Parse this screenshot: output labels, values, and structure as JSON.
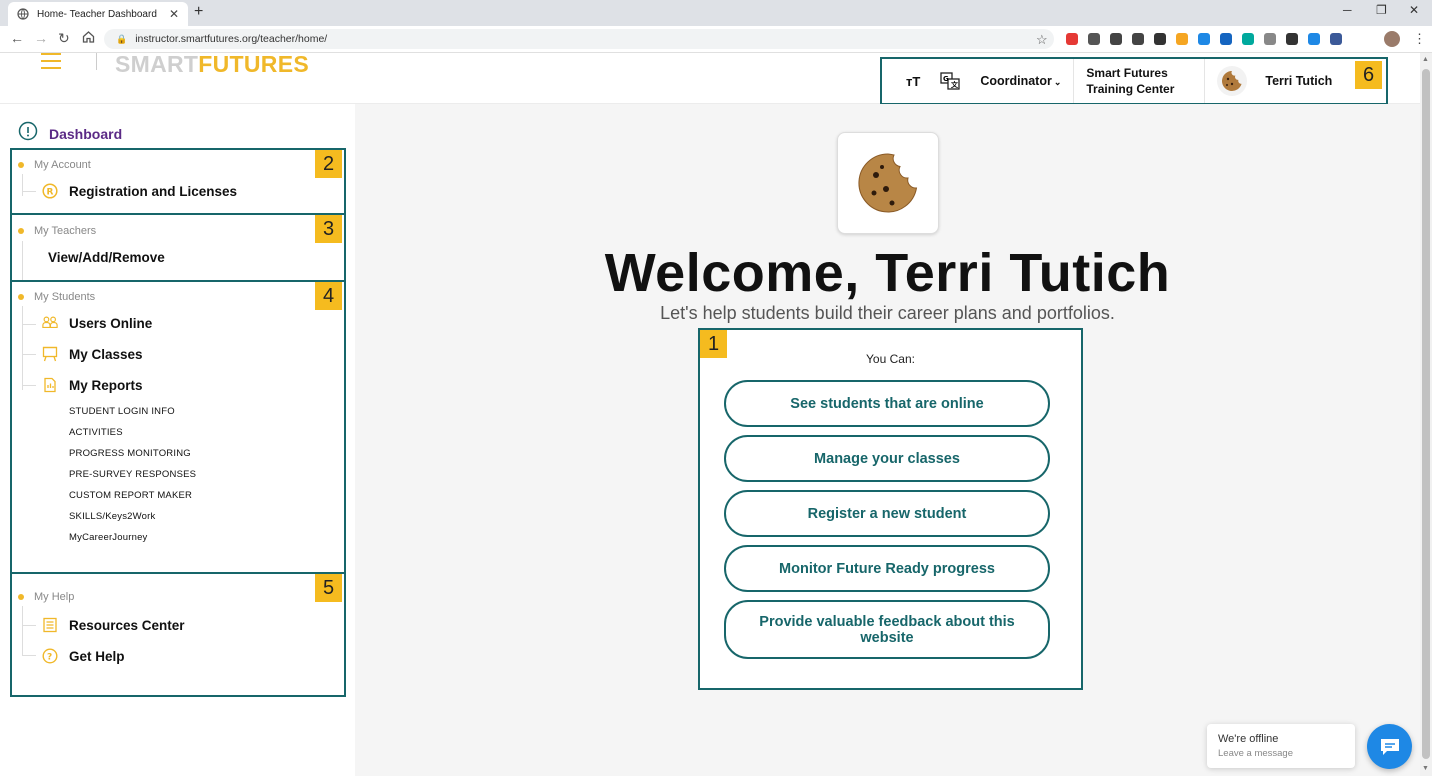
{
  "browser": {
    "tab_title": "Home- Teacher Dashboard",
    "tab_close": "✕",
    "new_tab": "+",
    "url": "instructor.smartfutures.org/teacher/home/",
    "extension_colors": [
      "#e53935",
      "#555555",
      "#444444",
      "#444444",
      "#333333",
      "#f5a623",
      "#1e88e5",
      "#1565c0",
      "#00a99d",
      "#888888",
      "#333333",
      "#1e88e5",
      "#3b5998"
    ]
  },
  "header": {
    "logo_part1": "SMART",
    "logo_part2": "FUTURES",
    "text_size": "ᴛT",
    "role": "Coordinator",
    "org_line1": "Smart Futures",
    "org_line2": "Training Center",
    "user_name": "Terri Tutich",
    "tag": "6"
  },
  "sidebar": {
    "dashboard": "Dashboard",
    "account": {
      "tag": "2",
      "section": "My Account",
      "items": [
        "Registration and Licenses"
      ]
    },
    "teachers": {
      "tag": "3",
      "section": "My Teachers",
      "items": [
        "View/Add/Remove"
      ]
    },
    "students": {
      "tag": "4",
      "section": "My Students",
      "items": [
        "Users Online",
        "My Classes",
        "My Reports"
      ],
      "reports": [
        "STUDENT LOGIN INFO",
        "ACTIVITIES",
        "PROGRESS MONITORING",
        "PRE-SURVEY RESPONSES",
        "CUSTOM REPORT MAKER",
        "SKILLS/Keys2Work",
        "MyCareerJourney"
      ]
    },
    "help": {
      "tag": "5",
      "section": "My Help",
      "items": [
        "Resources Center",
        "Get Help"
      ]
    }
  },
  "main": {
    "welcome": "Welcome, Terri Tutich",
    "tagline": "Let's help students build their career plans and portfolios.",
    "tag": "1",
    "you_can": "You Can:",
    "actions": [
      "See students that are online",
      "Manage your classes",
      "Register a new student",
      "Monitor Future Ready progress",
      "Provide valuable feedback about this website"
    ]
  },
  "chat": {
    "status": "We're offline",
    "prompt": "Leave a message"
  },
  "colors": {
    "teal": "#17666a",
    "gold": "#f0b82a",
    "purple": "#5b2a86",
    "tag_yellow": "#f5bb1f"
  }
}
